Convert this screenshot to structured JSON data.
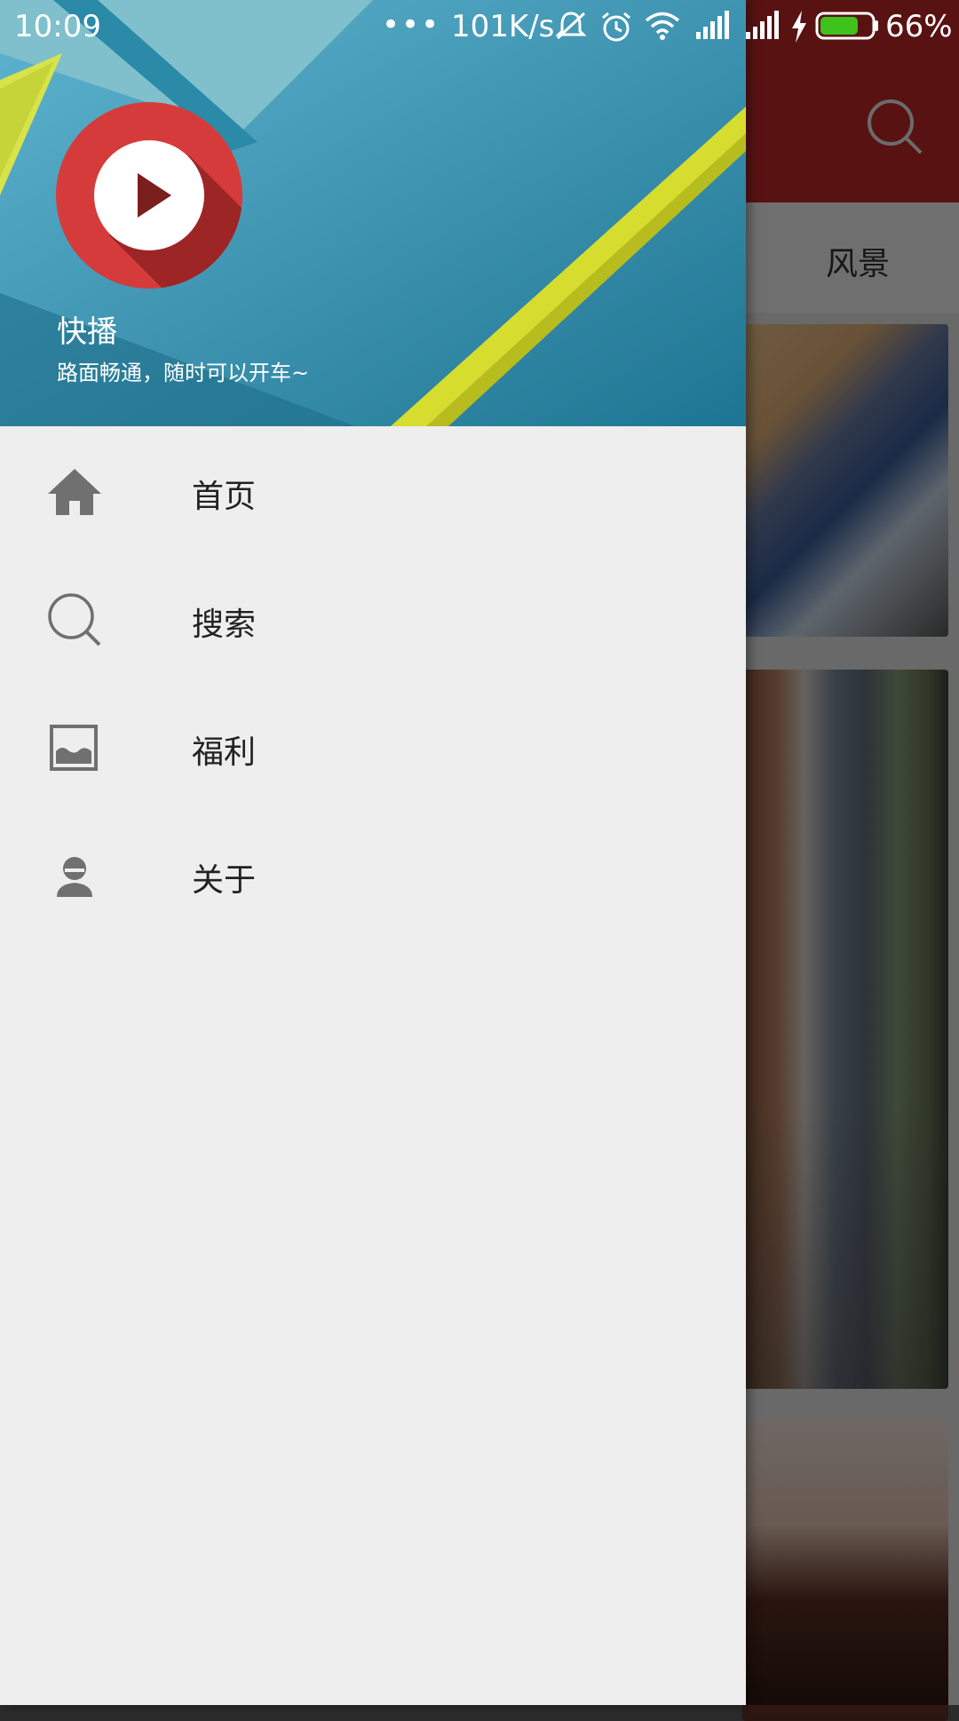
{
  "status_bar": {
    "time": "10:09",
    "dots": "•••",
    "network_speed": "101K/s",
    "battery": "66%"
  },
  "background_app": {
    "tab_visible": "风景",
    "toolbar_color": "#c62828"
  },
  "drawer": {
    "header": {
      "app_name": "快播",
      "tagline": "路面畅通，随时可以开车~"
    },
    "items": [
      {
        "label": "首页",
        "icon": "home-icon"
      },
      {
        "label": "搜索",
        "icon": "search-icon"
      },
      {
        "label": "福利",
        "icon": "image-icon"
      },
      {
        "label": "关于",
        "icon": "person-icon"
      }
    ]
  },
  "colors": {
    "drawer_bg": "#eeeeee",
    "icon_gray": "#707070",
    "logo_red": "#d63b3b"
  }
}
